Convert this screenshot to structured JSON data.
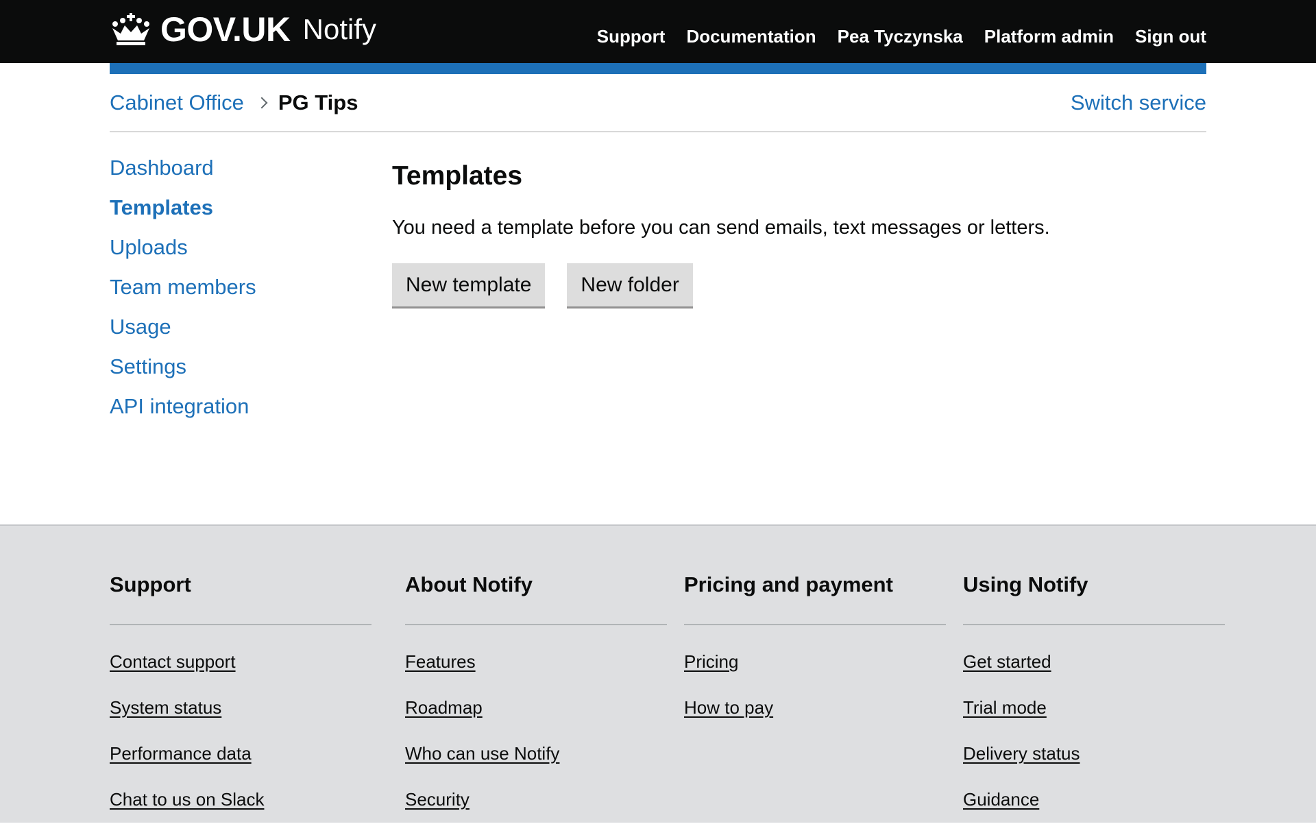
{
  "header": {
    "brand": "GOV.UK",
    "product": "Notify",
    "nav": [
      {
        "label": "Support",
        "name": "nav-support"
      },
      {
        "label": "Documentation",
        "name": "nav-documentation"
      },
      {
        "label": "Pea Tyczynska",
        "name": "nav-user-profile"
      },
      {
        "label": "Platform admin",
        "name": "nav-platform-admin"
      },
      {
        "label": "Sign out",
        "name": "nav-sign-out"
      }
    ]
  },
  "breadcrumb": {
    "organisation": "Cabinet Office",
    "service": "PG Tips",
    "switch_label": "Switch service"
  },
  "sidenav": [
    {
      "label": "Dashboard",
      "active": false
    },
    {
      "label": "Templates",
      "active": true
    },
    {
      "label": "Uploads",
      "active": false
    },
    {
      "label": "Team members",
      "active": false
    },
    {
      "label": "Usage",
      "active": false
    },
    {
      "label": "Settings",
      "active": false
    },
    {
      "label": "API integration",
      "active": false
    }
  ],
  "main": {
    "title": "Templates",
    "intro": "You need a template before you can send emails, text messages or letters.",
    "new_template_label": "New template",
    "new_folder_label": "New folder"
  },
  "footer": {
    "columns": [
      {
        "heading": "Support",
        "links": [
          "Contact support",
          "System status",
          "Performance data",
          "Chat to us on Slack"
        ]
      },
      {
        "heading": "About Notify",
        "links": [
          "Features",
          "Roadmap",
          "Who can use Notify",
          "Security"
        ]
      },
      {
        "heading": "Pricing and payment",
        "links": [
          "Pricing",
          "How to pay"
        ]
      },
      {
        "heading": "Using Notify",
        "links": [
          "Get started",
          "Trial mode",
          "Delivery status",
          "Guidance"
        ]
      }
    ]
  },
  "colors": {
    "header_bg": "#0b0c0c",
    "link_blue": "#1d70b8",
    "footer_bg": "#dedfe1",
    "button_bg": "#dddddd"
  }
}
